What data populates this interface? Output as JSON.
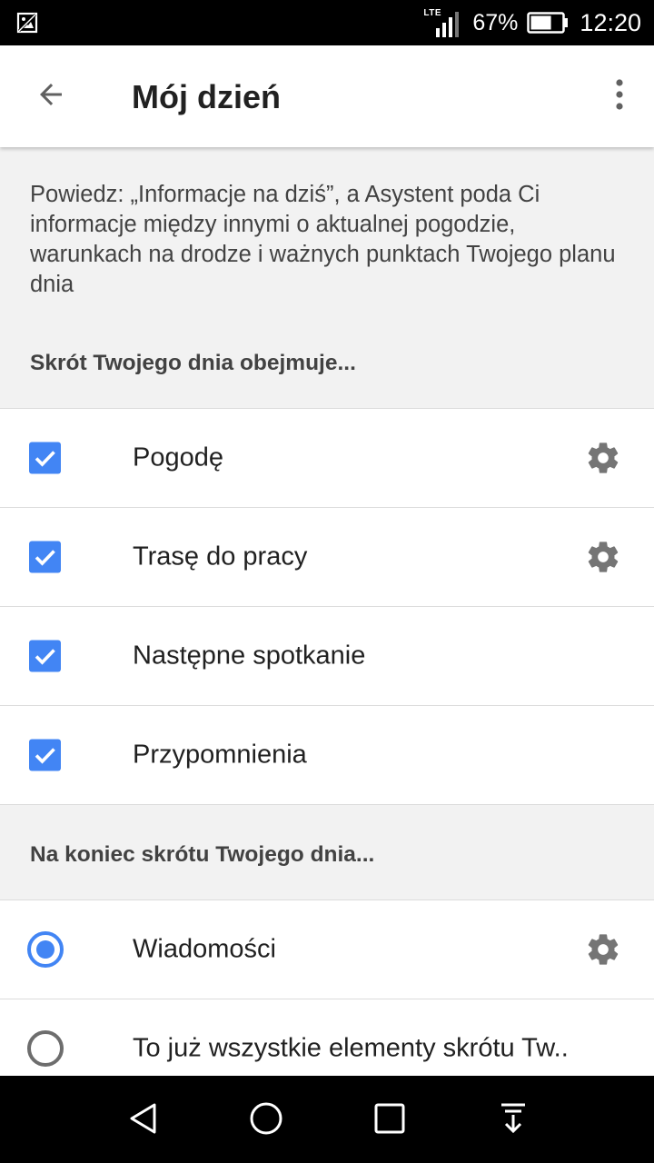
{
  "status_bar": {
    "network": "LTE",
    "battery_percent": "67%",
    "time": "12:20",
    "left_icon": "image-icon",
    "battery_level": 0.67
  },
  "app_bar": {
    "title": "Mój dzień",
    "back_icon": "arrow-back-icon",
    "menu_icon": "more-vert-icon"
  },
  "description": "Powiedz: „Informacje na dziś”, a Asystent poda Ci informacje między innymi o aktualnej pogodzie, warunkach na drodze i ważnych punktach Twojego planu dnia",
  "section1": {
    "header": "Skrót Twojego dnia obejmuje...",
    "items": [
      {
        "label": "Pogodę",
        "checked": true,
        "has_settings": true
      },
      {
        "label": "Trasę do pracy",
        "checked": true,
        "has_settings": true
      },
      {
        "label": "Następne spotkanie",
        "checked": true,
        "has_settings": false
      },
      {
        "label": "Przypomnienia",
        "checked": true,
        "has_settings": false
      }
    ]
  },
  "section2": {
    "header": "Na koniec skrótu Twojego dnia...",
    "items": [
      {
        "label": "Wiadomości",
        "selected": true,
        "has_settings": true
      },
      {
        "label": "To już wszystkie elementy skrótu Tw..",
        "selected": false,
        "has_settings": false
      }
    ]
  },
  "colors": {
    "accent": "#4285f4",
    "background": "#f2f2f2",
    "icon_gray": "#757575"
  },
  "nav_bar": {
    "buttons": [
      "back-triangle-icon",
      "home-circle-icon",
      "recents-square-icon",
      "notification-pull-icon"
    ]
  }
}
